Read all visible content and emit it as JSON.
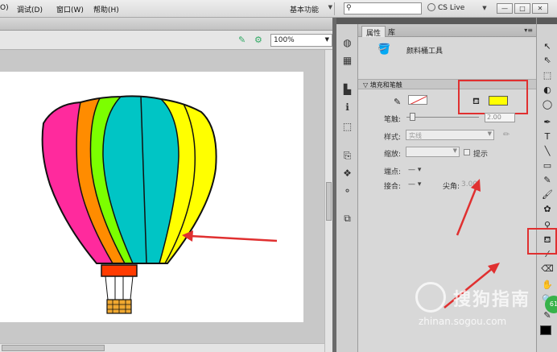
{
  "menu": {
    "items": [
      "O)",
      "调试(D)",
      "窗口(W)",
      "帮助(H)"
    ],
    "workspace": "基本功能",
    "cs_live": "CS Live",
    "window_buttons": [
      "—",
      "□",
      "✕"
    ]
  },
  "document": {
    "zoom": "100%"
  },
  "properties": {
    "tabs": [
      "属性",
      "库"
    ],
    "tool_name": "颜料桶工具",
    "section_title": "填充和笔触",
    "stroke_label": "笔触:",
    "stroke_value": "2.00",
    "style_label": "样式:",
    "style_value": "实线",
    "scale_label": "缩放:",
    "hint_label": "提示",
    "cap_label": "端点:",
    "join_label": "接合:",
    "miter_label": "尖角:",
    "miter_value": "3.00",
    "dash": "— ▾"
  },
  "colors": {
    "fill": "#ffff00",
    "stroke": "#ffffff",
    "annotation": "#e03030",
    "balloon": [
      "#ff2a9d",
      "#ff8c00",
      "#7cff00",
      "#00c5c5",
      "#ffff00"
    ]
  },
  "watermark": {
    "text": "搜狗指南",
    "url": "zhinan.sogou.com"
  },
  "badge": "61"
}
